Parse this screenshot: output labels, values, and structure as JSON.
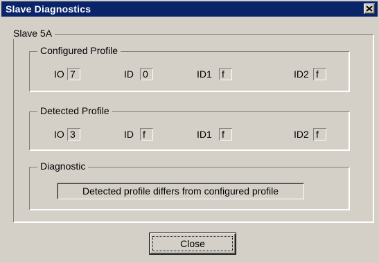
{
  "window": {
    "title": "Slave Diagnostics",
    "close_icon": "close-icon"
  },
  "slave": {
    "label": "Slave 5A"
  },
  "configured_profile": {
    "label": "Configured Profile",
    "fields": [
      {
        "label": "IO",
        "value": "7"
      },
      {
        "label": "ID",
        "value": "0"
      },
      {
        "label": "ID1",
        "value": "f"
      },
      {
        "label": "ID2",
        "value": "f"
      }
    ]
  },
  "detected_profile": {
    "label": "Detected Profile",
    "fields": [
      {
        "label": "IO",
        "value": "3"
      },
      {
        "label": "ID",
        "value": "f"
      },
      {
        "label": "ID1",
        "value": "f"
      },
      {
        "label": "ID2",
        "value": "f"
      }
    ]
  },
  "diagnostic": {
    "label": "Diagnostic",
    "message": "Detected profile differs from configured profile"
  },
  "buttons": {
    "close_label": "Close"
  },
  "colors": {
    "titlebar": "#0a246a",
    "face": "#d4d0c8"
  }
}
